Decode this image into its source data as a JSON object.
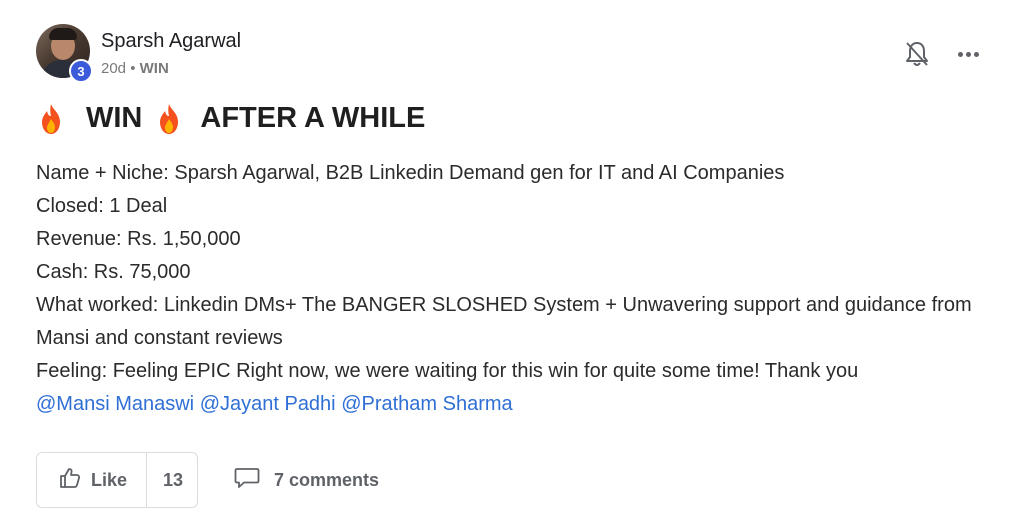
{
  "post": {
    "author": {
      "name": "Sparsh Agarwal",
      "level": "3"
    },
    "time_ago": "20d",
    "separator": "•",
    "category": "WIN",
    "title": {
      "word1": "WIN",
      "word2": "AFTER A WHILE"
    },
    "body_lines": [
      "Name + Niche: Sparsh Agarwal, B2B Linkedin Demand gen for IT and AI Companies",
      "Closed: 1 Deal",
      "Revenue: Rs. 1,50,000",
      "Cash: Rs. 75,000",
      "What worked: Linkedin DMs+ The BANGER SLOSHED System + Unwavering support and guidance from Mansi and constant reviews",
      "Feeling: Feeling EPIC Right now, we were waiting for this win for quite some time! Thank you"
    ],
    "mentions": [
      "@Mansi Manaswi",
      "@Jayant Padhi",
      "@Pratham Sharma"
    ],
    "like_label": "Like",
    "like_count": "13",
    "comments_label": "7 comments"
  },
  "colors": {
    "mention": "#2f6fd6",
    "level_badge": "#3b5bdb",
    "fire": "#f4511e"
  },
  "icons": [
    "fire-icon",
    "bell-off-icon",
    "more-icon",
    "thumbs-up-icon",
    "comment-icon"
  ]
}
